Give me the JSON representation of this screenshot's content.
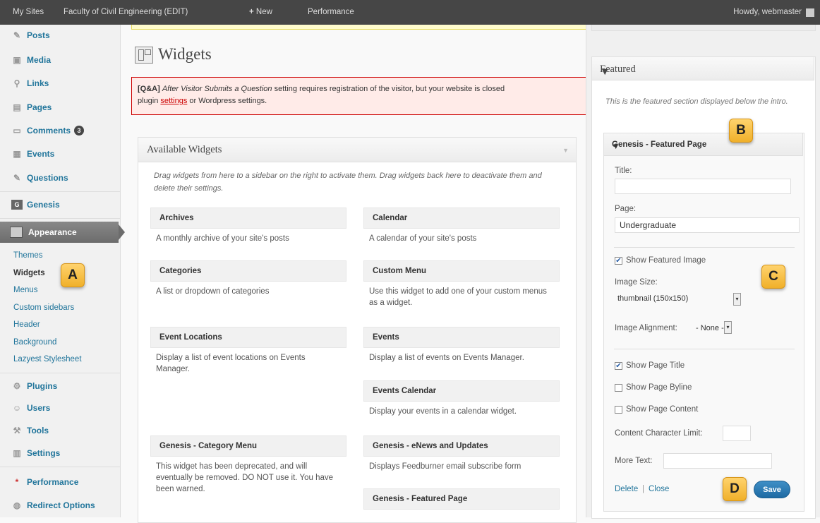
{
  "admin_bar": {
    "my_sites": "My Sites",
    "site_name": "Faculty of Civil Engineering (EDIT)",
    "new_label": "New",
    "performance": "Performance",
    "howdy": "Howdy, webmaster"
  },
  "sidebar": {
    "items": [
      {
        "label": "Posts",
        "icon": "pushpin-icon"
      },
      {
        "label": "Media",
        "icon": "media-icon"
      },
      {
        "label": "Links",
        "icon": "link-icon"
      },
      {
        "label": "Pages",
        "icon": "page-icon"
      },
      {
        "label": "Comments",
        "icon": "comment-icon",
        "badge": "3"
      },
      {
        "label": "Events",
        "icon": "calendar-icon"
      },
      {
        "label": "Questions",
        "icon": "pushpin-icon"
      },
      {
        "label": "Genesis",
        "icon": "genesis-icon"
      },
      {
        "label": "Appearance",
        "icon": "appearance-icon"
      },
      {
        "label": "Plugins",
        "icon": "plugin-icon"
      },
      {
        "label": "Users",
        "icon": "users-icon"
      },
      {
        "label": "Tools",
        "icon": "tools-icon"
      },
      {
        "label": "Settings",
        "icon": "settings-icon"
      },
      {
        "label": "Performance",
        "icon": "performance-icon"
      },
      {
        "label": "Redirect Options",
        "icon": "redirect-icon"
      }
    ],
    "appearance_sub": [
      "Themes",
      "Widgets",
      "Menus",
      "Custom sidebars",
      "Header",
      "Background",
      "Lazyest Stylesheet"
    ]
  },
  "markers": {
    "a": "A",
    "b": "B",
    "c": "C",
    "d": "D"
  },
  "page": {
    "title": "Widgets",
    "notice_prefix": "[Q&A]",
    "notice_italic": "After Visitor Submits a Question",
    "notice_text": " setting requires registration of the visitor, but your website is closed",
    "notice_line2_pre": "plugin ",
    "notice_link": "settings",
    "notice_line2_post": " or Wordpress settings."
  },
  "available_widgets": {
    "title": "Available Widgets",
    "description": "Drag widgets from here to a sidebar on the right to activate them. Drag widgets back here to deactivate them and delete their settings.",
    "widgets": [
      {
        "title": "Archives",
        "desc": "A monthly archive of your site's posts"
      },
      {
        "title": "Calendar",
        "desc": "A calendar of your site's posts"
      },
      {
        "title": "Categories",
        "desc": "A list or dropdown of categories"
      },
      {
        "title": "Custom Menu",
        "desc": "Use this widget to add one of your custom menus as a widget."
      },
      {
        "title": "Event Locations",
        "desc": "Display a list of event locations on Events Manager."
      },
      {
        "title": "Events",
        "desc": "Display a list of events on Events Manager."
      },
      {
        "title": "Events Calendar",
        "desc": "Display your events in a calendar widget."
      },
      {
        "title": "Genesis - Category Menu",
        "desc": "This widget has been deprecated, and will eventually be removed. DO NOT use it. You have been warned."
      },
      {
        "title": "Genesis - eNews and Updates",
        "desc": "Displays Feedburner email subscribe form"
      },
      {
        "title": "Genesis - Featured Page",
        "desc": ""
      }
    ]
  },
  "featured": {
    "title": "Featured",
    "description": "This is the featured section displayed below the intro.",
    "widget_title": "Genesis - Featured Page",
    "title_label": "Title:",
    "title_value": "",
    "page_label": "Page:",
    "page_value": "Undergraduate",
    "show_featured_image": "Show Featured Image",
    "image_size_label": "Image Size:",
    "image_size_value": "thumbnail (150x150)",
    "image_alignment_label": "Image Alignment:",
    "image_alignment_value": "- None -",
    "show_page_title": "Show Page Title",
    "show_page_byline": "Show Page Byline",
    "show_page_content": "Show Page Content",
    "content_limit_label": "Content Character Limit:",
    "more_text_label": "More Text:",
    "delete_label": "Delete",
    "separator": "|",
    "close_label": "Close",
    "save_label": "Save",
    "checkbox_states": {
      "show_featured_image": true,
      "show_page_title": true,
      "show_page_byline": false,
      "show_page_content": false
    }
  }
}
